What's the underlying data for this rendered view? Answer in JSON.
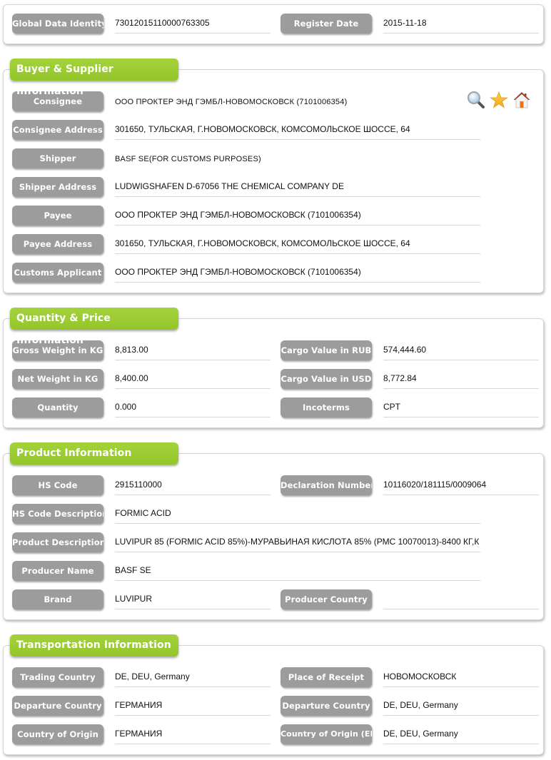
{
  "header": {
    "global_data_identity_label": "Global Data Identity",
    "global_data_identity": "73012015110000763305",
    "register_date_label": "Register Date",
    "register_date": "2015-11-18"
  },
  "buyer_supplier": {
    "title": "Buyer & Supplier Information",
    "rows": [
      {
        "label": "Consignee",
        "value": "ООО ПРОКТЕР ЭНД ГЭМБЛ-НОВОМОСКОВСК (7101006354)"
      },
      {
        "label": "Consignee Address",
        "value": "301650, ТУЛЬСКАЯ, Г.НОВОМОСКОВСК, КОМСОМОЛЬСКОЕ ШОССЕ, 64"
      },
      {
        "label": "Shipper",
        "value": "BASF SE(FOR CUSTOMS PURPOSES)"
      },
      {
        "label": "Shipper Address",
        "value": "LUDWIGSHAFEN D-67056 THE CHEMICAL COMPANY DE"
      },
      {
        "label": "Payee",
        "value": "ООО ПРОКТЕР ЭНД ГЭМБЛ-НОВОМОСКОВСК (7101006354)"
      },
      {
        "label": "Payee Address",
        "value": "301650, ТУЛЬСКАЯ, Г.НОВОМОСКОВСК, КОМСОМОЛЬСКОЕ ШОССЕ, 64"
      },
      {
        "label": "Customs Applicant",
        "value": "ООО ПРОКТЕР ЭНД ГЭМБЛ-НОВОМОСКОВСК (7101006354)"
      }
    ],
    "icons": [
      "search-icon",
      "star-icon",
      "home-icon"
    ]
  },
  "quantity_price": {
    "title": "Quantity & Price Information",
    "left": [
      {
        "label": "Gross Weight in KG",
        "value": "8,813.00"
      },
      {
        "label": "Net Weight in KG",
        "value": "8,400.00"
      },
      {
        "label": "Quantity",
        "value": "0.000"
      }
    ],
    "right": [
      {
        "label": "Cargo Value in RUB",
        "value": "574,444.60"
      },
      {
        "label": "Cargo Value in USD",
        "value": "8,772.84"
      },
      {
        "label": "Incoterms",
        "value": "CPT"
      }
    ]
  },
  "product": {
    "title": "Product Information",
    "hs_code_label": "HS Code",
    "hs_code": "2915110000",
    "declaration_number_label": "Declaration Number",
    "declaration_number": "10116020/181115/0009064",
    "hs_code_description_label": "HS Code Description",
    "hs_code_description": "FORMIC ACID",
    "product_description_label": "Product Description",
    "product_description": "LUVIPUR 85 (FORMIC ACID 85%)-МУРАВЬИНАЯ КИСЛОТА 85% (РМС 10070013)-8400 КГ,К",
    "producer_name_label": "Producer Name",
    "producer_name": "BASF SE",
    "brand_label": "Brand",
    "brand": "LUVIPUR",
    "producer_country_label": "Producer Country",
    "producer_country": ""
  },
  "transportation": {
    "title": "Transportation Information",
    "left": [
      {
        "label": "Trading Country",
        "value": "DE, DEU, Germany"
      },
      {
        "label": "Departure Country",
        "value": "ГЕРМАНИЯ"
      },
      {
        "label": "Country of Origin",
        "value": "ГЕРМАНИЯ"
      }
    ],
    "right": [
      {
        "label": "Place of Receipt",
        "value": "НОВОМОСКОВСК"
      },
      {
        "label": "Departure Country",
        "value": "DE, DEU, Germany"
      },
      {
        "label": "Country of Origin (EN)",
        "value": "DE, DEU, Germany"
      }
    ]
  },
  "colors": {
    "section_title_bg": "#9acd32",
    "label_bg": "#9c9c9c",
    "text": "#111111"
  }
}
